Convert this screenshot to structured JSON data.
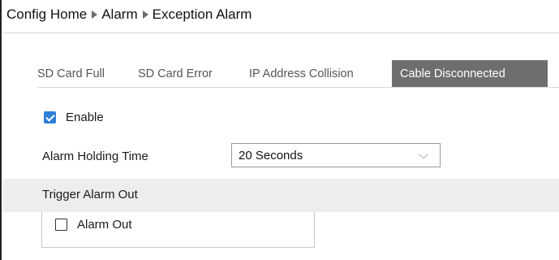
{
  "breadcrumb": {
    "items": [
      "Config Home",
      "Alarm",
      "Exception Alarm"
    ]
  },
  "tabs": [
    {
      "label": "SD Card Full",
      "active": false
    },
    {
      "label": "SD Card Error",
      "active": false
    },
    {
      "label": "IP Address Collision",
      "active": false
    },
    {
      "label": "Cable Disconnected",
      "active": true
    }
  ],
  "enable": {
    "label": "Enable",
    "checked": true
  },
  "holding_time": {
    "label": "Alarm Holding Time",
    "value": "20 Seconds",
    "icon": "chevron-down-icon"
  },
  "trigger": {
    "title": "Trigger Alarm Out",
    "alarm_out_label": "Alarm Out",
    "alarm_out_checked": false
  },
  "colors": {
    "active_tab_bg": "#6e6e6e",
    "checkbox_accent": "#2f7fd8",
    "section_bg": "#ededed"
  }
}
